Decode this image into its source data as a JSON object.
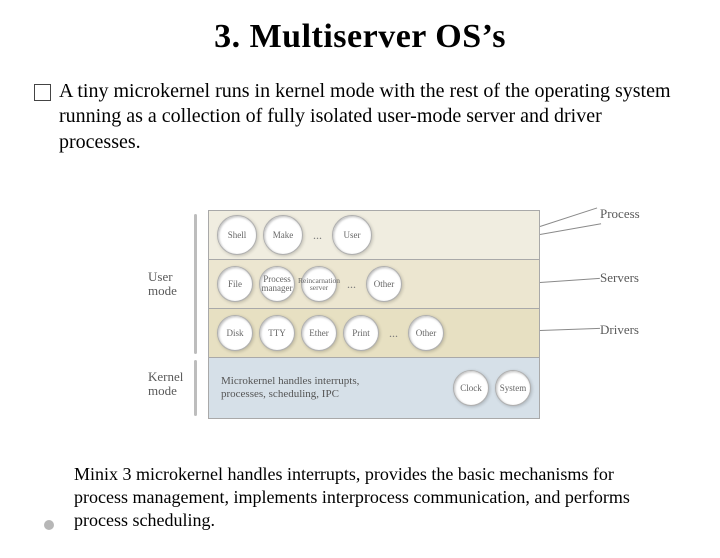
{
  "title": "3. Multiserver OS’s",
  "bullet": "A tiny microkernel runs in kernel mode with the rest of the operating system running as a collection of fully isolated user-mode server and driver processes.",
  "caption": "Minix 3 microkernel handles interrupts, provides the basic mechanisms for process management, implements interprocess communication, and performs process scheduling.",
  "diagram": {
    "left_labels": {
      "user": "User\nmode",
      "kernel": "Kernel\nmode"
    },
    "right_labels": {
      "process": "Process",
      "servers": "Servers",
      "drivers": "Drivers"
    },
    "rows": {
      "r0": [
        "Shell",
        "Make",
        "...",
        "User"
      ],
      "r1": [
        "File",
        "Process\nmanager",
        "Reincarnation\nserver",
        "...",
        "Other"
      ],
      "r2": [
        "Disk",
        "TTY",
        "Ether",
        "Print",
        "...",
        "Other"
      ],
      "r3_text": "Microkernel handles interrupts,\nprocesses, scheduling, IPC",
      "r3": [
        "Clock",
        "System"
      ]
    }
  }
}
